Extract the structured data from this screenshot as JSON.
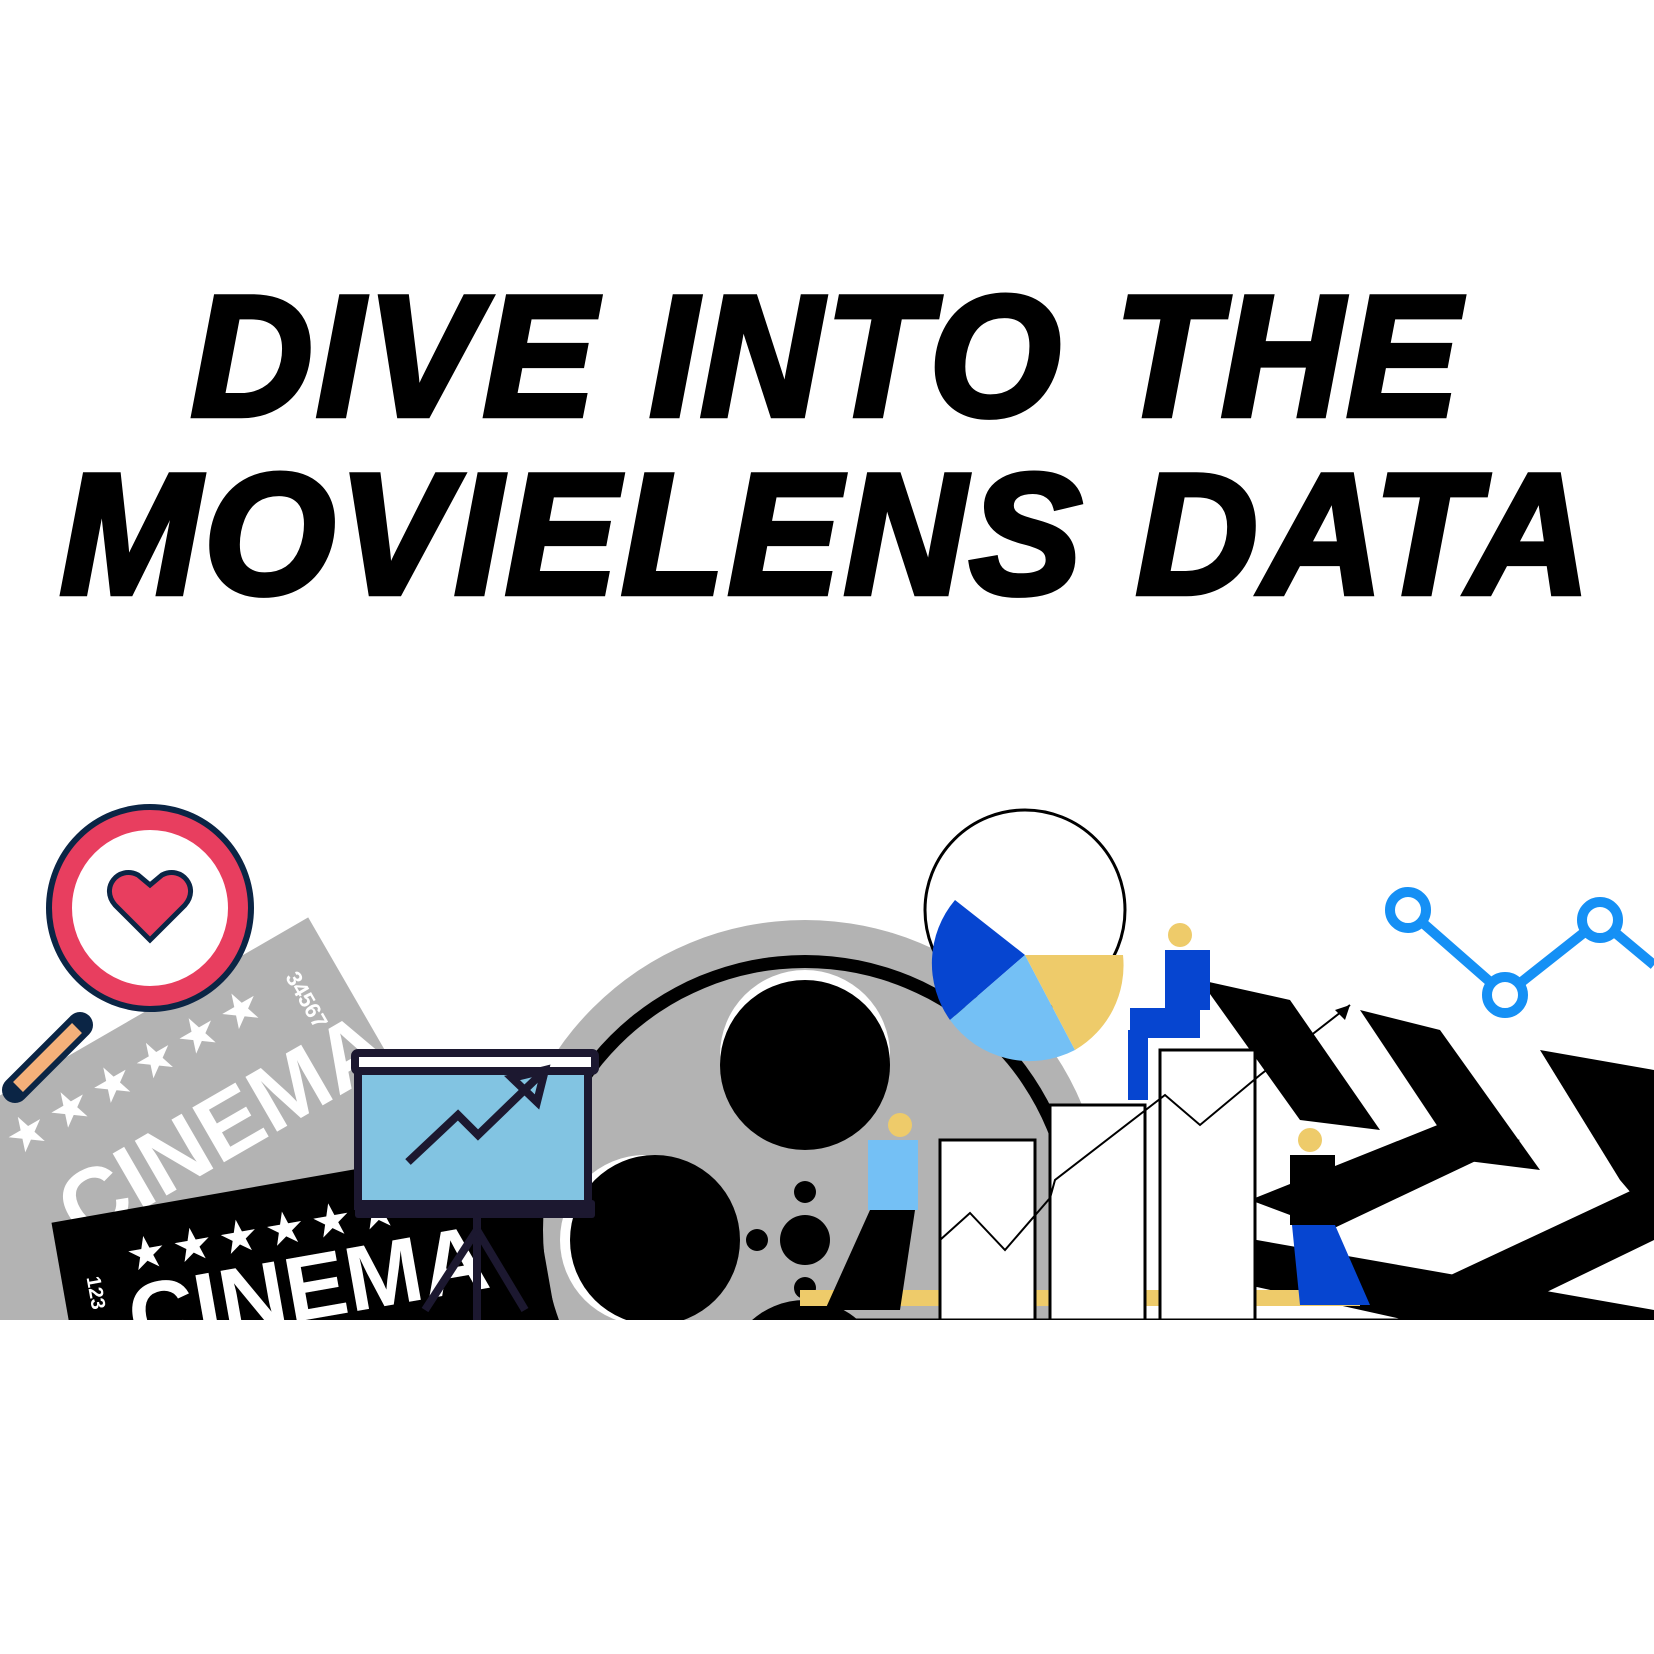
{
  "title": {
    "line1": "DIVE INTO THE",
    "line2": "MOVIELENS DATA"
  },
  "illustration": {
    "ticket_label": "CINEMA",
    "ticket_serial_grey": "34567",
    "ticket_serial_grey_left": "567",
    "ticket_serial_black": "123",
    "icons": [
      "magnifier-heart-icon",
      "cinema-ticket",
      "presentation-board-icon",
      "film-reel-icon",
      "pie-chart-icon",
      "bar-chart-icon",
      "line-chart-icon",
      "clapperboard-icon"
    ]
  },
  "colors": {
    "heart": "#e83e5f",
    "navy": "#0b2545",
    "handle": "#f4b07a",
    "board": "#82c4e2",
    "grey": "#b3b3b3",
    "blue": "#0645d0",
    "lightblue": "#74c0f5",
    "yellow": "#eecb6a",
    "line_chart": "#1590f5"
  }
}
